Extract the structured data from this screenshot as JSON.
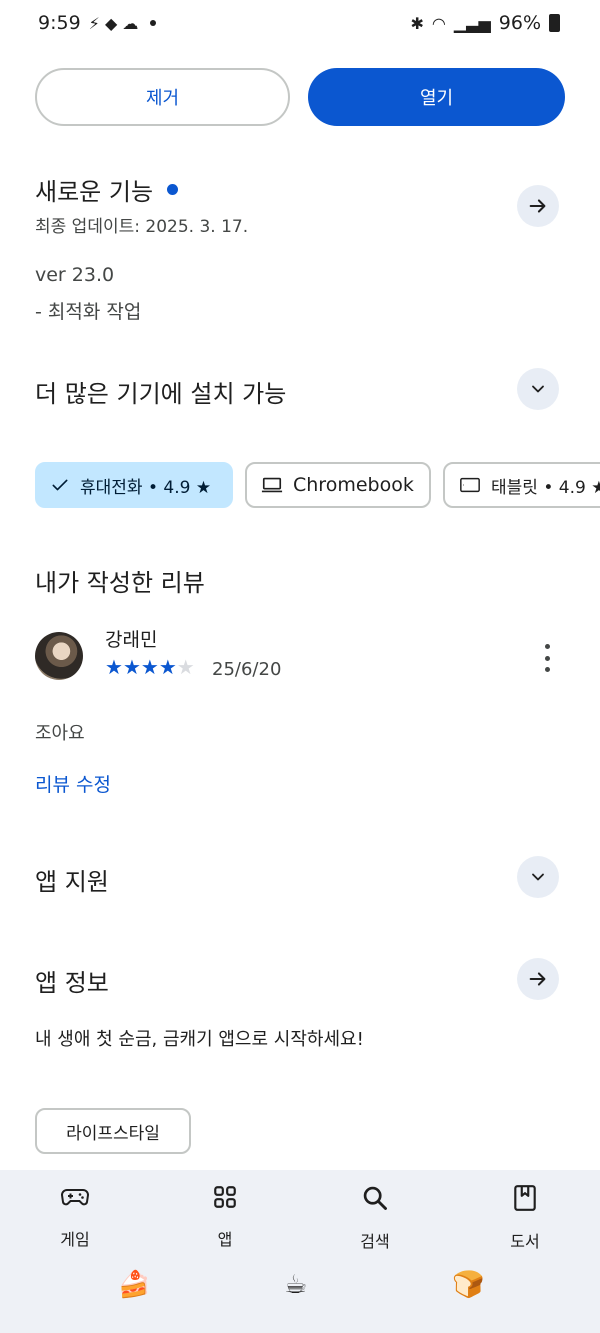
{
  "status_bar": {
    "time": "9:59",
    "battery": "96%"
  },
  "actions": {
    "remove_label": "제거",
    "open_label": "열기"
  },
  "whats_new": {
    "title": "새로운 기능",
    "updated": "최종 업데이트: 2025. 3. 17.",
    "version": "ver 23.0",
    "notes": "- 최적화 작업"
  },
  "devices": {
    "title": "더 많은 기기에 설치 가능",
    "chips": [
      {
        "label": "휴대전화 • 4.9 ★",
        "selected": true,
        "icon": "check-icon"
      },
      {
        "label": "Chromebook",
        "selected": false,
        "icon": "laptop-icon"
      },
      {
        "label": "태블릿 • 4.9 ★",
        "selected": false,
        "icon": "tablet-icon"
      }
    ]
  },
  "my_review": {
    "title": "내가 작성한 리뷰",
    "reviewer": "강래민",
    "rating": 4,
    "max_rating": 5,
    "date": "25/6/20",
    "text": "조아요",
    "edit_label": "리뷰 수정"
  },
  "app_support": {
    "title": "앱 지원"
  },
  "app_info": {
    "title": "앱 정보",
    "description": "내 생애 첫 순금, 금캐기 앱으로 시작하세요!",
    "tag": "라이프스타일"
  },
  "bottom_nav": {
    "items": [
      {
        "label": "게임",
        "icon": "gamepad-icon"
      },
      {
        "label": "앱",
        "icon": "apps-grid-icon"
      },
      {
        "label": "검색",
        "icon": "search-icon"
      },
      {
        "label": "도서",
        "icon": "book-icon"
      }
    ]
  },
  "colors": {
    "accent": "#0b57d0",
    "chip_selected": "#c2e7ff",
    "nav_background": "#eef1f6"
  }
}
